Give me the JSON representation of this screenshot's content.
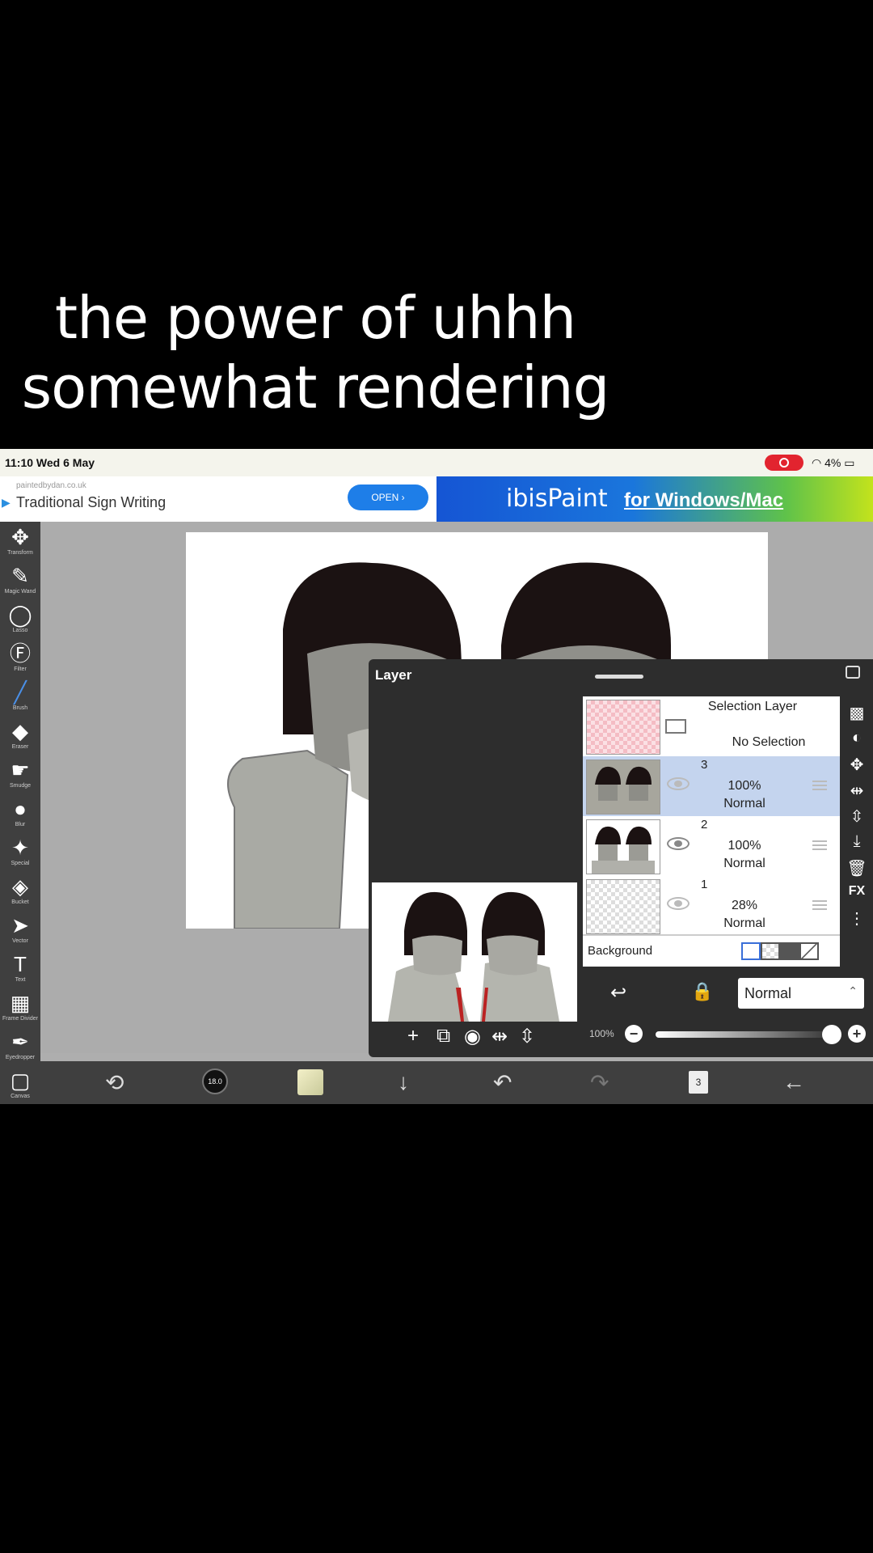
{
  "caption": {
    "line1": "the power of uhhh",
    "line2": "somewhat rendering"
  },
  "status": {
    "time": "11:10  Wed 6 May",
    "battery": "4%"
  },
  "ad": {
    "domain": "paintedbydan.co.uk",
    "title": "Traditional Sign Writing",
    "open": "OPEN ›",
    "brand": "ibisPaint",
    "tagline": "for Windows/Mac"
  },
  "tools": [
    {
      "label": "Transform",
      "icon": "move-icon",
      "glyph": "✥"
    },
    {
      "label": "Magic Wand",
      "icon": "magic-wand-icon",
      "glyph": "✎"
    },
    {
      "label": "Lasso",
      "icon": "lasso-icon",
      "glyph": "◯"
    },
    {
      "label": "Filter",
      "icon": "filter-icon",
      "glyph": "Ⓕ"
    },
    {
      "label": "Brush",
      "icon": "brush-icon",
      "glyph": "╱"
    },
    {
      "label": "Eraser",
      "icon": "eraser-icon",
      "glyph": "◆"
    },
    {
      "label": "Smudge",
      "icon": "smudge-icon",
      "glyph": "☛"
    },
    {
      "label": "Blur",
      "icon": "blur-icon",
      "glyph": "●"
    },
    {
      "label": "Special",
      "icon": "special-icon",
      "glyph": "✦"
    },
    {
      "label": "Bucket",
      "icon": "bucket-icon",
      "glyph": "◈"
    },
    {
      "label": "Vector",
      "icon": "vector-icon",
      "glyph": "➤"
    },
    {
      "label": "Text",
      "icon": "text-icon",
      "glyph": "T"
    },
    {
      "label": "Frame Divider",
      "icon": "frame-divider-icon",
      "glyph": "▦"
    },
    {
      "label": "Eyedropper",
      "icon": "eyedropper-icon",
      "glyph": "✒"
    },
    {
      "label": "Canvas",
      "icon": "canvas-icon",
      "glyph": "▢"
    }
  ],
  "bottom": {
    "brush_size": "18.0",
    "layer_count": "3"
  },
  "panel": {
    "title": "Layer",
    "selection": {
      "title": "Selection Layer",
      "subtitle": "No Selection"
    },
    "layers": [
      {
        "num": "3",
        "opacity": "100%",
        "mode": "Normal"
      },
      {
        "num": "2",
        "opacity": "100%",
        "mode": "Normal"
      },
      {
        "num": "1",
        "opacity": "28%",
        "mode": "Normal"
      }
    ],
    "background": "Background",
    "fx": "FX",
    "blend_mode": "Normal",
    "opacity_label": "100%"
  },
  "colors": {
    "accent": "#4a90e8",
    "selected_row": "#c4d4ee",
    "toolbar": "#3f3f3f"
  }
}
